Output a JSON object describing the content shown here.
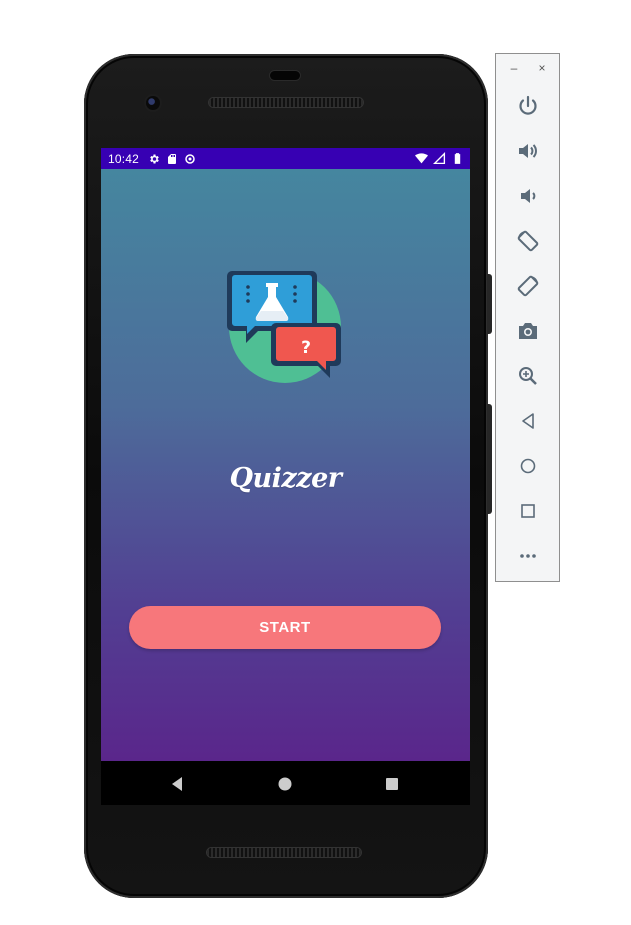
{
  "statusbar": {
    "time": "10:42",
    "left_icons": [
      "settings-icon",
      "sd-card-icon",
      "data-saver-icon"
    ],
    "right_icons": [
      "wifi-icon",
      "cell-signal-icon",
      "battery-icon"
    ],
    "background": "#3700b3"
  },
  "app": {
    "title": "Quizzer",
    "start_label": "START",
    "logo": "quiz-flask-chat-logo",
    "logo_question_mark": "?",
    "colors": {
      "gradient_top": "#45869f",
      "gradient_bottom": "#5a268b",
      "button": "#f7777b"
    }
  },
  "navbar": {
    "icons": [
      "back-icon",
      "home-icon",
      "recents-icon"
    ]
  },
  "emulator_toolbar": {
    "window_controls": [
      "minimize-icon",
      "close-icon"
    ],
    "minimize_glyph": "–",
    "close_glyph": "×",
    "buttons": [
      "power-icon",
      "volume-up-icon",
      "volume-down-icon",
      "rotate-left-icon",
      "rotate-right-icon",
      "camera-icon",
      "zoom-icon",
      "back-icon",
      "home-icon",
      "overview-icon",
      "more-icon"
    ]
  }
}
